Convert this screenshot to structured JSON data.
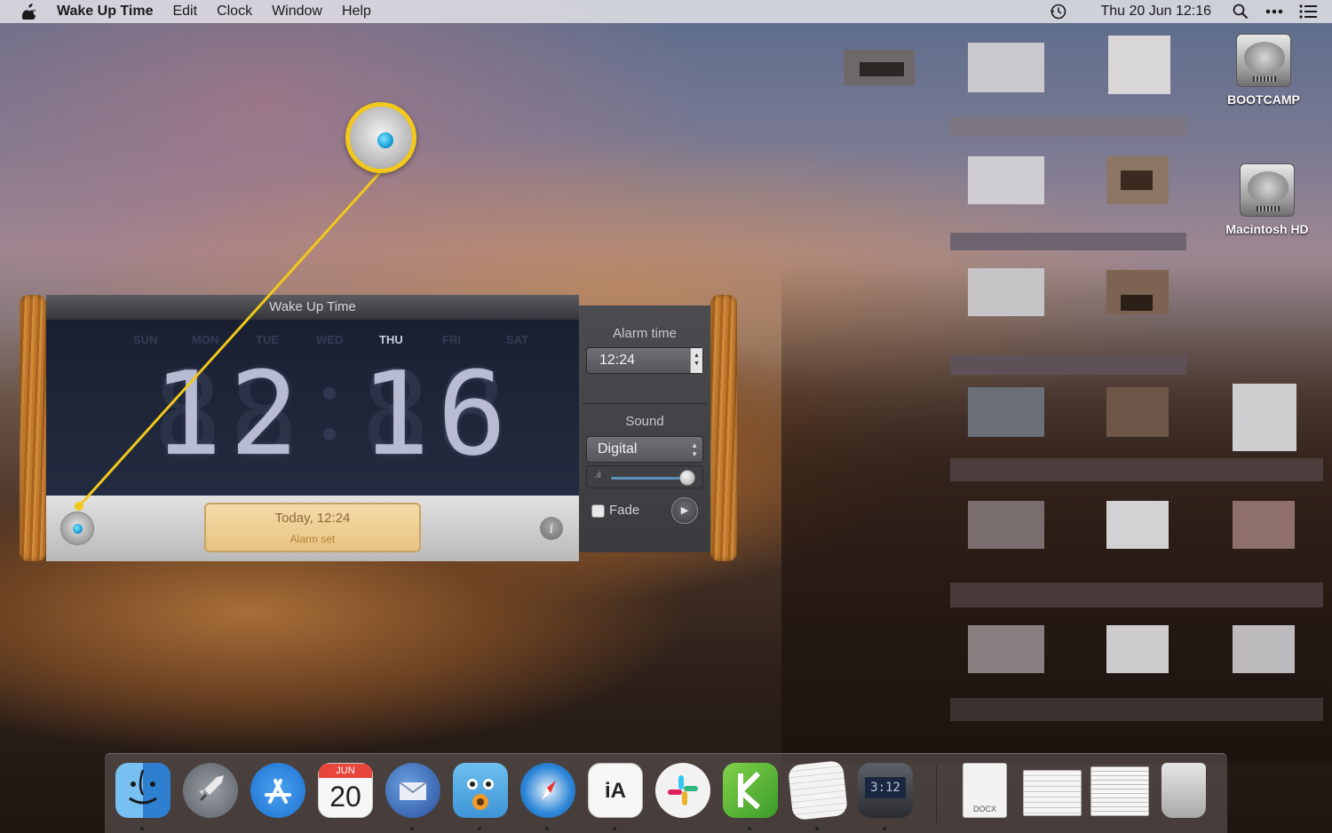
{
  "menubar": {
    "app_name": "Wake Up Time",
    "items": [
      "Edit",
      "Clock",
      "Window",
      "Help"
    ],
    "clock": "Thu 20 Jun  12:16",
    "icons": [
      "apple-icon",
      "time-machine-icon",
      "spotlight-search-icon",
      "more-icon",
      "notification-center-icon"
    ]
  },
  "desktop": {
    "disks": [
      {
        "label": "BOOTCAMP"
      },
      {
        "label": "Macintosh HD"
      }
    ]
  },
  "widget": {
    "title": "Wake Up Time",
    "days": [
      "SUN",
      "MON",
      "TUE",
      "WED",
      "THU",
      "FRI",
      "SAT"
    ],
    "active_day": "THU",
    "hours": "12",
    "minutes": "16",
    "status_line1": "Today, 12:24",
    "status_line2": "Alarm set",
    "info_label": "i",
    "alarm_time_label": "Alarm time",
    "alarm_time_value": "12:24",
    "sound_label": "Sound",
    "sound_value": "Digital",
    "fade_label": "Fade",
    "fade_checked": false,
    "volume_level": 0.95
  },
  "dock": {
    "apps": [
      {
        "name": "finder-icon",
        "color": "#5aa7e8"
      },
      {
        "name": "launchpad-icon",
        "color": "#7a7f86"
      },
      {
        "name": "app-store-icon",
        "color": "#2f8ee8"
      },
      {
        "name": "calendar-icon",
        "color": "#f4f4f4"
      },
      {
        "name": "thunderbird-icon",
        "color": "#3e70b6"
      },
      {
        "name": "tweetbot-icon",
        "color": "#5fb0e6"
      },
      {
        "name": "safari-icon",
        "color": "#2d86d8"
      },
      {
        "name": "ia-writer-icon",
        "color": "#f4f4f4"
      },
      {
        "name": "slack-icon",
        "color": "#f2f2f2"
      },
      {
        "name": "kite-icon",
        "color": "#6bbf3a"
      },
      {
        "name": "textedit-icon",
        "color": "#e9e9e9"
      },
      {
        "name": "wake-up-time-icon",
        "color": "#3a3c42"
      }
    ],
    "calendar": {
      "month": "JUN",
      "day": "20"
    },
    "docs": [
      {
        "name": "docx-file-icon",
        "label": "DOCX"
      },
      {
        "name": "document-stack-icon",
        "label": ""
      },
      {
        "name": "text-document-icon",
        "label": ""
      },
      {
        "name": "trash-icon",
        "label": ""
      }
    ],
    "accent": "#f2c81a"
  }
}
